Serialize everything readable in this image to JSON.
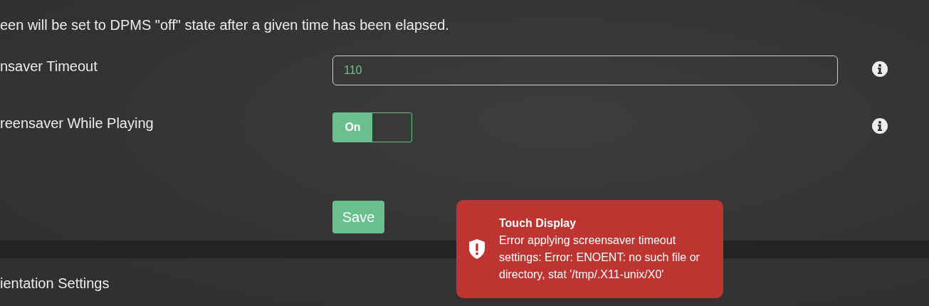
{
  "description": "een will be set to DPMS \"off\" state after a given time has been elapsed.",
  "settings": [
    {
      "kind": "input",
      "label": "nsaver Timeout",
      "value": "110"
    },
    {
      "kind": "toggle",
      "label": "reensaver While Playing",
      "on": true,
      "on_label": "On"
    }
  ],
  "save_button": "Save",
  "next_section": {
    "title": "ientation Settings"
  },
  "toast": {
    "title": "Touch Display",
    "message": "Error applying screensaver timeout settings: Error: ENOENT: no such file or directory, stat '/tmp/.X11-unix/X0'"
  }
}
